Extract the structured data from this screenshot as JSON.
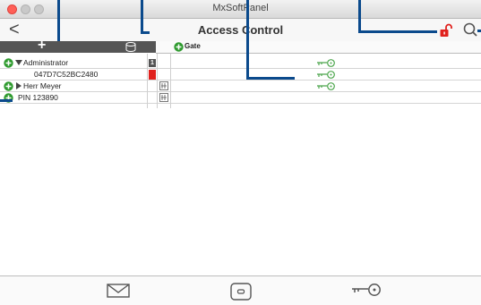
{
  "window": {
    "title": "MxSoftPanel"
  },
  "nav": {
    "title": "Access Control",
    "back": "<",
    "icons": {
      "lock": "unlock-icon",
      "search": "search-icon"
    }
  },
  "toolbar": {
    "add": "+",
    "gate_label": "Gate"
  },
  "rows": [
    {
      "label": "Administrator",
      "badge": "1",
      "key": true
    },
    {
      "label": "047D7C52BC2480",
      "key": true
    },
    {
      "label": "Herr Meyer",
      "key": true
    },
    {
      "label": "PIN 123890",
      "key": false
    }
  ],
  "colors": {
    "accent": "#0b4a8c",
    "red": "#e0211d",
    "green": "#2e9a2e",
    "key_green": "#4aa54a"
  },
  "bottom": {
    "icons": [
      "mail-icon",
      "device-icon",
      "key-icon"
    ]
  }
}
